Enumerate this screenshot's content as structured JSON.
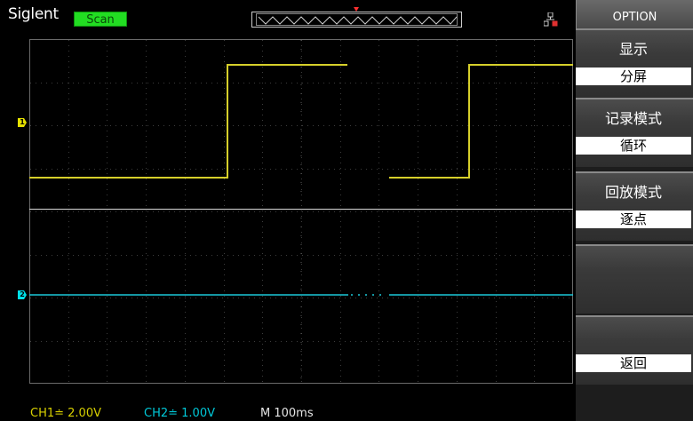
{
  "header": {
    "brand": "Siglent",
    "status_badge": "Scan"
  },
  "channels": {
    "ch1_marker": "1",
    "ch2_marker": "2",
    "ch1_scale": "CH1≐ 2.00V",
    "ch2_scale": "CH2≐ 1.00V"
  },
  "timebase": "M 100ms",
  "colors": {
    "ch1": "#d6cf2a",
    "ch2": "#1bc7d8",
    "status": "#22dd22"
  },
  "menu": {
    "header": "OPTION",
    "items": [
      {
        "title": "显示",
        "value": "分屏"
      },
      {
        "title": "记录模式",
        "value": "循环"
      },
      {
        "title": "回放模式",
        "value": "逐点"
      },
      {
        "title": "",
        "value": ""
      },
      {
        "title": "",
        "value": "返回"
      }
    ]
  }
}
